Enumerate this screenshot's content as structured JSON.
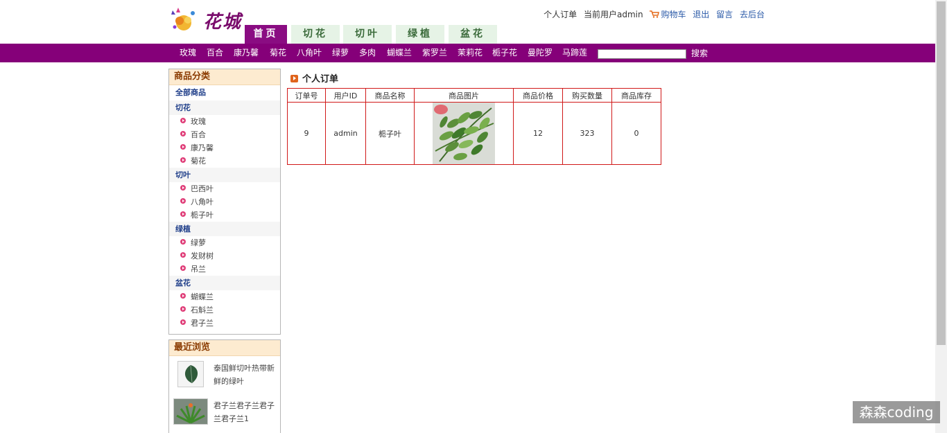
{
  "header": {
    "brand": "花城",
    "links": {
      "my_orders": "个人订单",
      "current_user": "当前用户admin",
      "cart": "购物车",
      "logout": "退出",
      "message": "留言",
      "admin": "去后台"
    },
    "tabs": [
      "首页",
      "切花",
      "切叶",
      "绿植",
      "盆花"
    ]
  },
  "navbar": {
    "items": [
      "玫瑰",
      "百合",
      "康乃馨",
      "菊花",
      "八角叶",
      "绿萝",
      "多肉",
      "蝴蝶兰",
      "紫罗兰",
      "茉莉花",
      "栀子花",
      "曼陀罗",
      "马蹄莲"
    ],
    "search_value": "",
    "search_button": "搜索"
  },
  "sidebar": {
    "categories_title": "商品分类",
    "all_products": "全部商品",
    "groups": [
      {
        "name": "切花",
        "items": [
          "玫瑰",
          "百合",
          "康乃馨",
          "菊花"
        ]
      },
      {
        "name": "切叶",
        "items": [
          "巴西叶",
          "八角叶",
          "栀子叶"
        ]
      },
      {
        "name": "绿植",
        "items": [
          "绿萝",
          "发财树",
          "吊兰"
        ]
      },
      {
        "name": "盆花",
        "items": [
          "蝴蝶兰",
          "石斛兰",
          "君子兰"
        ]
      }
    ],
    "recent_title": "最近浏览",
    "recent": [
      {
        "title": "泰国鲜切叶热带新鲜的绿叶"
      },
      {
        "title": "君子兰君子兰君子兰君子兰1"
      }
    ]
  },
  "main": {
    "title": "个人订单",
    "table": {
      "headers": [
        "订单号",
        "用户ID",
        "商品名称",
        "商品图片",
        "商品价格",
        "购买数量",
        "商品库存"
      ],
      "rows": [
        {
          "order_id": "9",
          "user_id": "admin",
          "product_name": "栀子叶",
          "price": "12",
          "quantity": "323",
          "stock": "0"
        }
      ]
    }
  },
  "watermark": "森森coding",
  "colors": {
    "nav_purple": "#850079",
    "tab_green": "#e6f3e6",
    "table_border": "#d01818",
    "panel_head": "#fdebd0"
  }
}
